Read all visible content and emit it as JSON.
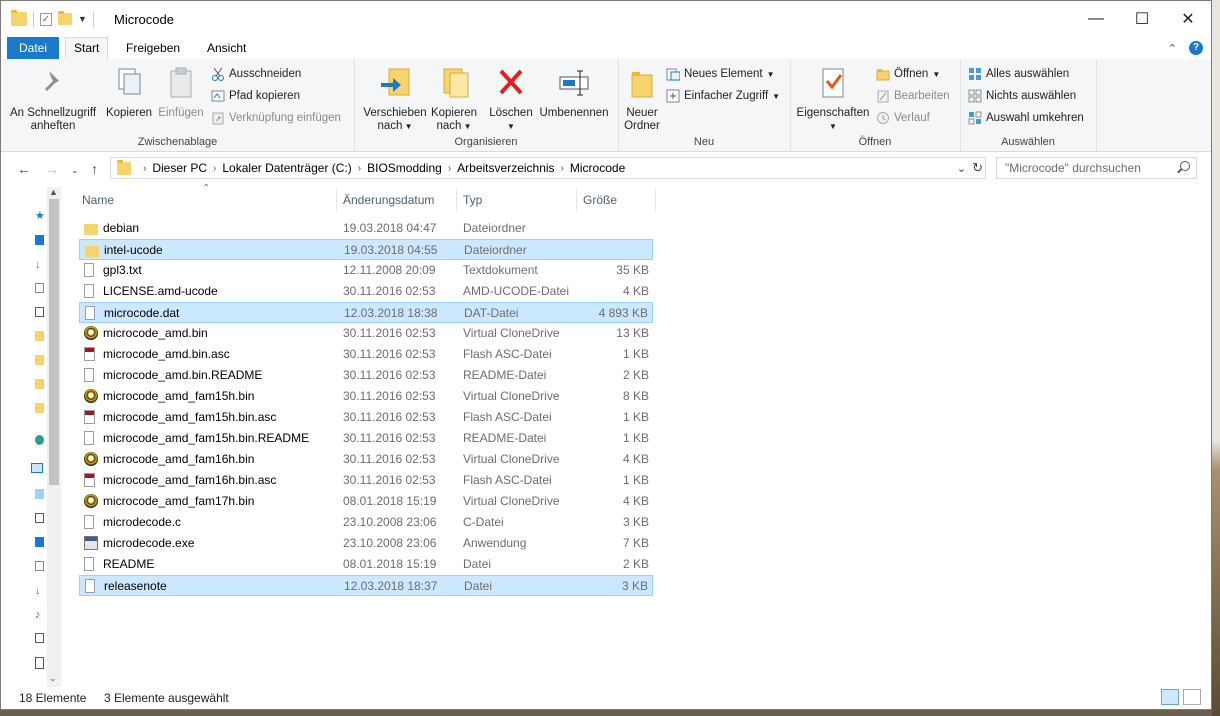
{
  "window": {
    "title": "Microcode"
  },
  "tabs": [
    "Datei",
    "Start",
    "Freigeben",
    "Ansicht"
  ],
  "ribbon": {
    "zwischenablage": {
      "label": "Zwischenablage",
      "pin": "An Schnellzugriff anheften",
      "copy": "Kopieren",
      "paste": "Einfügen",
      "cut": "Ausschneiden",
      "copy_path": "Pfad kopieren",
      "paste_link": "Verknüpfung einfügen"
    },
    "organisieren": {
      "label": "Organisieren",
      "move": "Verschieben nach",
      "copy_to": "Kopieren nach",
      "delete": "Löschen",
      "rename": "Umbenennen"
    },
    "neu": {
      "label": "Neu",
      "new_folder": "Neuer Ordner",
      "new_item": "Neues Element",
      "easy_access": "Einfacher Zugriff"
    },
    "oeffnen": {
      "label": "Öffnen",
      "properties": "Eigenschaften",
      "open": "Öffnen",
      "edit": "Bearbeiten",
      "history": "Verlauf"
    },
    "auswaehlen": {
      "label": "Auswählen",
      "select_all": "Alles auswählen",
      "select_none": "Nichts auswählen",
      "invert": "Auswahl umkehren"
    }
  },
  "address": {
    "crumbs": [
      "Dieser PC",
      "Lokaler Datenträger (C:)",
      "BIOSmodding",
      "Arbeitsverzeichnis",
      "Microcode"
    ],
    "search_placeholder": "\"Microcode\" durchsuchen"
  },
  "columns": {
    "name": "Name",
    "date": "Änderungsdatum",
    "type": "Typ",
    "size": "Größe"
  },
  "files": [
    {
      "name": "debian",
      "date": "19.03.2018 04:47",
      "type": "Dateiordner",
      "size": "",
      "icon": "folder-icon",
      "selected": false
    },
    {
      "name": "intel-ucode",
      "date": "19.03.2018 04:55",
      "type": "Dateiordner",
      "size": "",
      "icon": "folder-icon",
      "selected": true
    },
    {
      "name": "gpl3.txt",
      "date": "12.11.2008 20:09",
      "type": "Textdokument",
      "size": "35 KB",
      "icon": "text-file-icon",
      "selected": false
    },
    {
      "name": "LICENSE.amd-ucode",
      "date": "30.11.2016 02:53",
      "type": "AMD-UCODE-Datei",
      "size": "4 KB",
      "icon": "file-icon",
      "selected": false
    },
    {
      "name": "microcode.dat",
      "date": "12.03.2018 18:38",
      "type": "DAT-Datei",
      "size": "4 893 KB",
      "icon": "file-icon",
      "selected": true
    },
    {
      "name": "microcode_amd.bin",
      "date": "30.11.2016 02:53",
      "type": "Virtual CloneDrive",
      "size": "13 KB",
      "icon": "clonedrive-icon",
      "selected": false
    },
    {
      "name": "microcode_amd.bin.asc",
      "date": "30.11.2016 02:53",
      "type": "Flash ASC-Datei",
      "size": "1 KB",
      "icon": "flash-file-icon",
      "selected": false
    },
    {
      "name": "microcode_amd.bin.README",
      "date": "30.11.2016 02:53",
      "type": "README-Datei",
      "size": "2 KB",
      "icon": "file-icon",
      "selected": false
    },
    {
      "name": "microcode_amd_fam15h.bin",
      "date": "30.11.2016 02:53",
      "type": "Virtual CloneDrive",
      "size": "8 KB",
      "icon": "clonedrive-icon",
      "selected": false
    },
    {
      "name": "microcode_amd_fam15h.bin.asc",
      "date": "30.11.2016 02:53",
      "type": "Flash ASC-Datei",
      "size": "1 KB",
      "icon": "flash-file-icon",
      "selected": false
    },
    {
      "name": "microcode_amd_fam15h.bin.README",
      "date": "30.11.2016 02:53",
      "type": "README-Datei",
      "size": "1 KB",
      "icon": "file-icon",
      "selected": false
    },
    {
      "name": "microcode_amd_fam16h.bin",
      "date": "30.11.2016 02:53",
      "type": "Virtual CloneDrive",
      "size": "4 KB",
      "icon": "clonedrive-icon",
      "selected": false
    },
    {
      "name": "microcode_amd_fam16h.bin.asc",
      "date": "30.11.2016 02:53",
      "type": "Flash ASC-Datei",
      "size": "1 KB",
      "icon": "flash-file-icon",
      "selected": false
    },
    {
      "name": "microcode_amd_fam17h.bin",
      "date": "08.01.2018 15:19",
      "type": "Virtual CloneDrive",
      "size": "4 KB",
      "icon": "clonedrive-icon",
      "selected": false
    },
    {
      "name": "microdecode.c",
      "date": "23.10.2008 23:06",
      "type": "C-Datei",
      "size": "3 KB",
      "icon": "file-icon",
      "selected": false
    },
    {
      "name": "microdecode.exe",
      "date": "23.10.2008 23:06",
      "type": "Anwendung",
      "size": "7 KB",
      "icon": "exe-icon",
      "selected": false
    },
    {
      "name": "README",
      "date": "08.01.2018 15:19",
      "type": "Datei",
      "size": "2 KB",
      "icon": "file-icon",
      "selected": false
    },
    {
      "name": "releasenote",
      "date": "12.03.2018 18:37",
      "type": "Datei",
      "size": "3 KB",
      "icon": "file-icon",
      "selected": true
    }
  ],
  "status": {
    "count": "18 Elemente",
    "selection": "3 Elemente ausgewählt"
  },
  "colors": {
    "accent": "#1979ca",
    "selection": "#cce8ff",
    "selection_border": "#99d1ff",
    "header_text": "#4c607a"
  }
}
